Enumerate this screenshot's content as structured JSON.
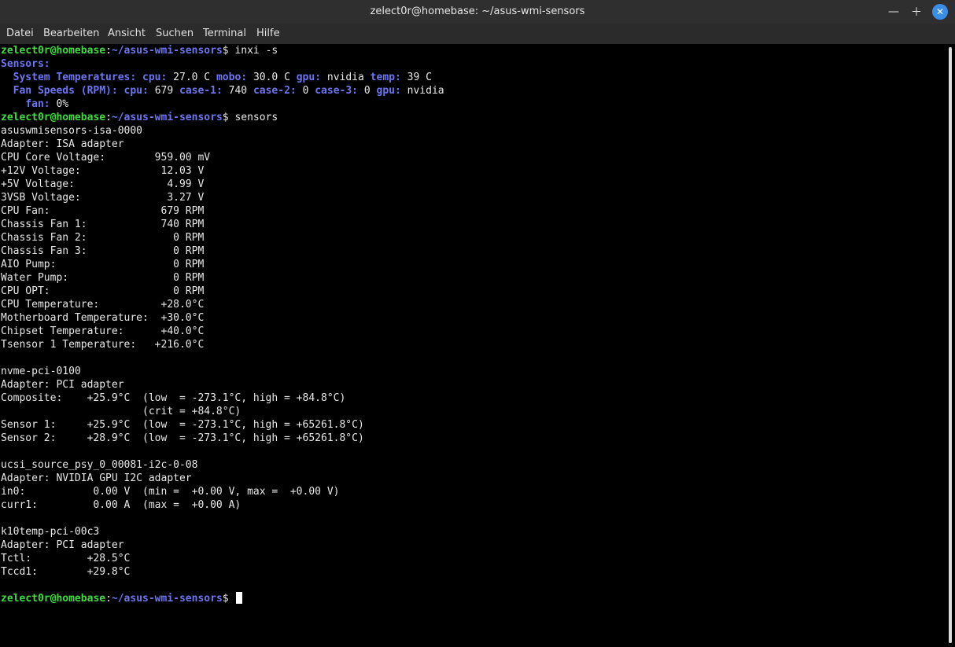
{
  "window": {
    "title": "zelect0r@homebase: ~/asus-wmi-sensors",
    "minimize_icon": "minimize-icon",
    "maximize_icon": "maximize-icon",
    "close_icon": "close-icon"
  },
  "menu": [
    "Datei",
    "Bearbeiten",
    "Ansicht",
    "Suchen",
    "Terminal",
    "Hilfe"
  ],
  "prompt": {
    "user": "zelect0r@homebase",
    "sep": ":",
    "path": "~/asus-wmi-sensors",
    "symbol": "$ "
  },
  "commands": {
    "cmd1": "inxi -s",
    "cmd2": "sensors"
  },
  "inxi": {
    "header": "Sensors:",
    "temp_label": "System Temperatures:",
    "cpu_k": "cpu:",
    "cpu_v": "27.0 C",
    "mobo_k": "mobo:",
    "mobo_v": "30.0 C",
    "gpu_k": "gpu:",
    "gpu_v": "nvidia",
    "temp_k": "temp:",
    "temp_v": "39 C",
    "fan_label": "Fan Speeds (RPM):",
    "fcpu_k": "cpu:",
    "fcpu_v": "679",
    "case1_k": "case-1:",
    "case1_v": "740",
    "case2_k": "case-2:",
    "case2_v": "0",
    "case3_k": "case-3:",
    "case3_v": "0",
    "fgpu_k": "gpu:",
    "fgpu_v": "nvidia",
    "fan_k": "fan:",
    "fan_v": "0%"
  },
  "sensors_output": [
    "asuswmisensors-isa-0000",
    "Adapter: ISA adapter",
    "CPU Core Voltage:        959.00 mV",
    "+12V Voltage:             12.03 V",
    "+5V Voltage:               4.99 V",
    "3VSB Voltage:              3.27 V",
    "CPU Fan:                  679 RPM",
    "Chassis Fan 1:            740 RPM",
    "Chassis Fan 2:              0 RPM",
    "Chassis Fan 3:              0 RPM",
    "AIO Pump:                   0 RPM",
    "Water Pump:                 0 RPM",
    "CPU OPT:                    0 RPM",
    "CPU Temperature:          +28.0°C",
    "Motherboard Temperature:  +30.0°C",
    "Chipset Temperature:      +40.0°C",
    "Tsensor 1 Temperature:   +216.0°C",
    "",
    "nvme-pci-0100",
    "Adapter: PCI adapter",
    "Composite:    +25.9°C  (low  = -273.1°C, high = +84.8°C)",
    "                       (crit = +84.8°C)",
    "Sensor 1:     +25.9°C  (low  = -273.1°C, high = +65261.8°C)",
    "Sensor 2:     +28.9°C  (low  = -273.1°C, high = +65261.8°C)",
    "",
    "ucsi_source_psy_0_00081-i2c-0-08",
    "Adapter: NVIDIA GPU I2C adapter",
    "in0:           0.00 V  (min =  +0.00 V, max =  +0.00 V)",
    "curr1:         0.00 A  (max =  +0.00 A)",
    "",
    "k10temp-pci-00c3",
    "Adapter: PCI adapter",
    "Tctl:         +28.5°C",
    "Tccd1:        +29.8°C",
    ""
  ]
}
